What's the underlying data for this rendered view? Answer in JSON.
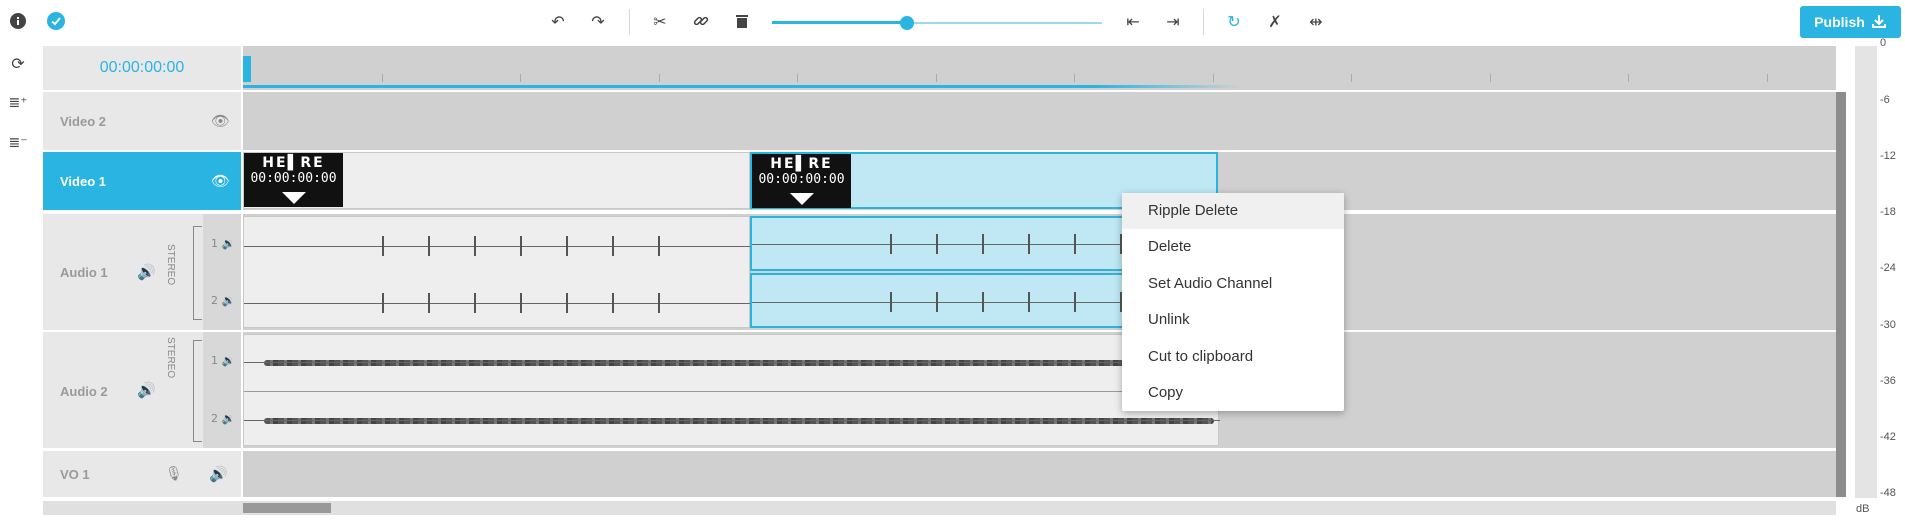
{
  "toolbar": {
    "publish_label": "Publish",
    "accent": "#2ab4e2"
  },
  "timeline": {
    "timecode": "00:00:00:00",
    "zoom_level_fraction": 0.4
  },
  "tracks": {
    "video2": "Video 2",
    "video1": "Video 1",
    "audio1": "Audio 1",
    "audio2": "Audio 2",
    "vo1": "VO 1",
    "stereo": "STEREO",
    "ch1": "1",
    "ch2": "2"
  },
  "clips": {
    "thumb_logo": "HE▌RE",
    "thumb_time": "00:00:00:00"
  },
  "context_menu": {
    "items": [
      "Ripple Delete",
      "Delete",
      "Set Audio Channel",
      "Unlink",
      "Cut to clipboard",
      "Copy"
    ]
  },
  "meter": {
    "labels": [
      "0",
      "-6",
      "-12",
      "-18",
      "-24",
      "-30",
      "-36",
      "-42",
      "-48"
    ],
    "unit": "dB"
  },
  "icons": {
    "info": "info-icon",
    "check": "check-circle-icon",
    "undo": "undo-icon",
    "redo": "redo-icon",
    "cut": "scissors-icon",
    "link": "link-icon",
    "delete": "trash-icon",
    "eye": "eye-icon",
    "speaker": "speaker-icon",
    "mic_muted": "mic-muted-icon"
  }
}
